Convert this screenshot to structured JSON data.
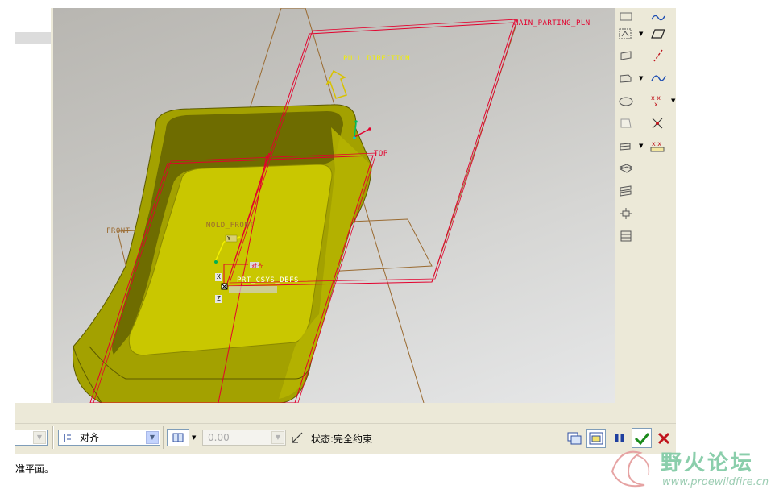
{
  "viewport": {
    "labels": {
      "main_parting_pln": "MAIN_PARTING_PLN",
      "pull_direction": "PULL DIRECTION",
      "top": "TOP",
      "front": "FRONT",
      "mold_front": "MOLD_FRONT",
      "prt_csys_defs": "PRT_CSYS_DEFS",
      "axis_x": "X",
      "axis_y": "Y",
      "axis_z": "Z",
      "csys_tag": "对齐"
    }
  },
  "dashboard": {
    "constraint_type": "对齐",
    "offset_value": "0.00",
    "status_label": "状态:完全约束"
  },
  "message_bar": {
    "text": "准平面。"
  },
  "watermark": {
    "title": "野火论坛",
    "url": "www.proewildfire.cn"
  },
  "colors": {
    "part_yellow": "#c8c800",
    "datum_red": "#e3002d",
    "datum_brown": "#9a6a30",
    "label_yellow": "#f2f000",
    "ok_green": "#1a8a1a",
    "cancel_red": "#c0141c"
  }
}
